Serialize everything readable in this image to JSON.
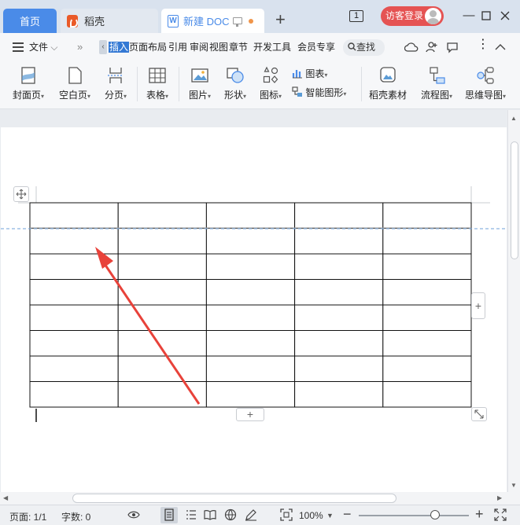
{
  "tabs": {
    "home": "首页",
    "docer": "稻壳",
    "doc": "新建 DOC",
    "doc_icon_letter": "W"
  },
  "titlebar": {
    "window_count": "1",
    "login": "访客登录",
    "icons": [
      "new-tab-icon",
      "window-count-icon",
      "avatar-icon",
      "minimize-icon",
      "maximize-icon",
      "close-icon"
    ]
  },
  "menu": {
    "file": "文件",
    "tabs": [
      "插入",
      "页面布局",
      "引用",
      "审阅",
      "视图",
      "章节",
      "开发工具",
      "会员专享"
    ],
    "search": "查找"
  },
  "ribbon": {
    "cover": "封面页",
    "blank": "空白页",
    "pagebreak": "分页",
    "table": "表格",
    "picture": "图片",
    "shape": "形状",
    "icon": "图标",
    "chart": "图表",
    "smartart": "智能图形",
    "material": "稻壳素材",
    "flowchart": "流程图",
    "mindmap": "思维导图"
  },
  "table": {
    "rows": 8,
    "cols": 5
  },
  "status": {
    "page": "页面: 1/1",
    "words": "字数: 0",
    "zoom": "100%",
    "zoom_level": 0.75
  },
  "colors": {
    "accent": "#4a8be8",
    "login": "#e55353",
    "arrow": "#e8423a",
    "guide": "#6fa0d8"
  }
}
